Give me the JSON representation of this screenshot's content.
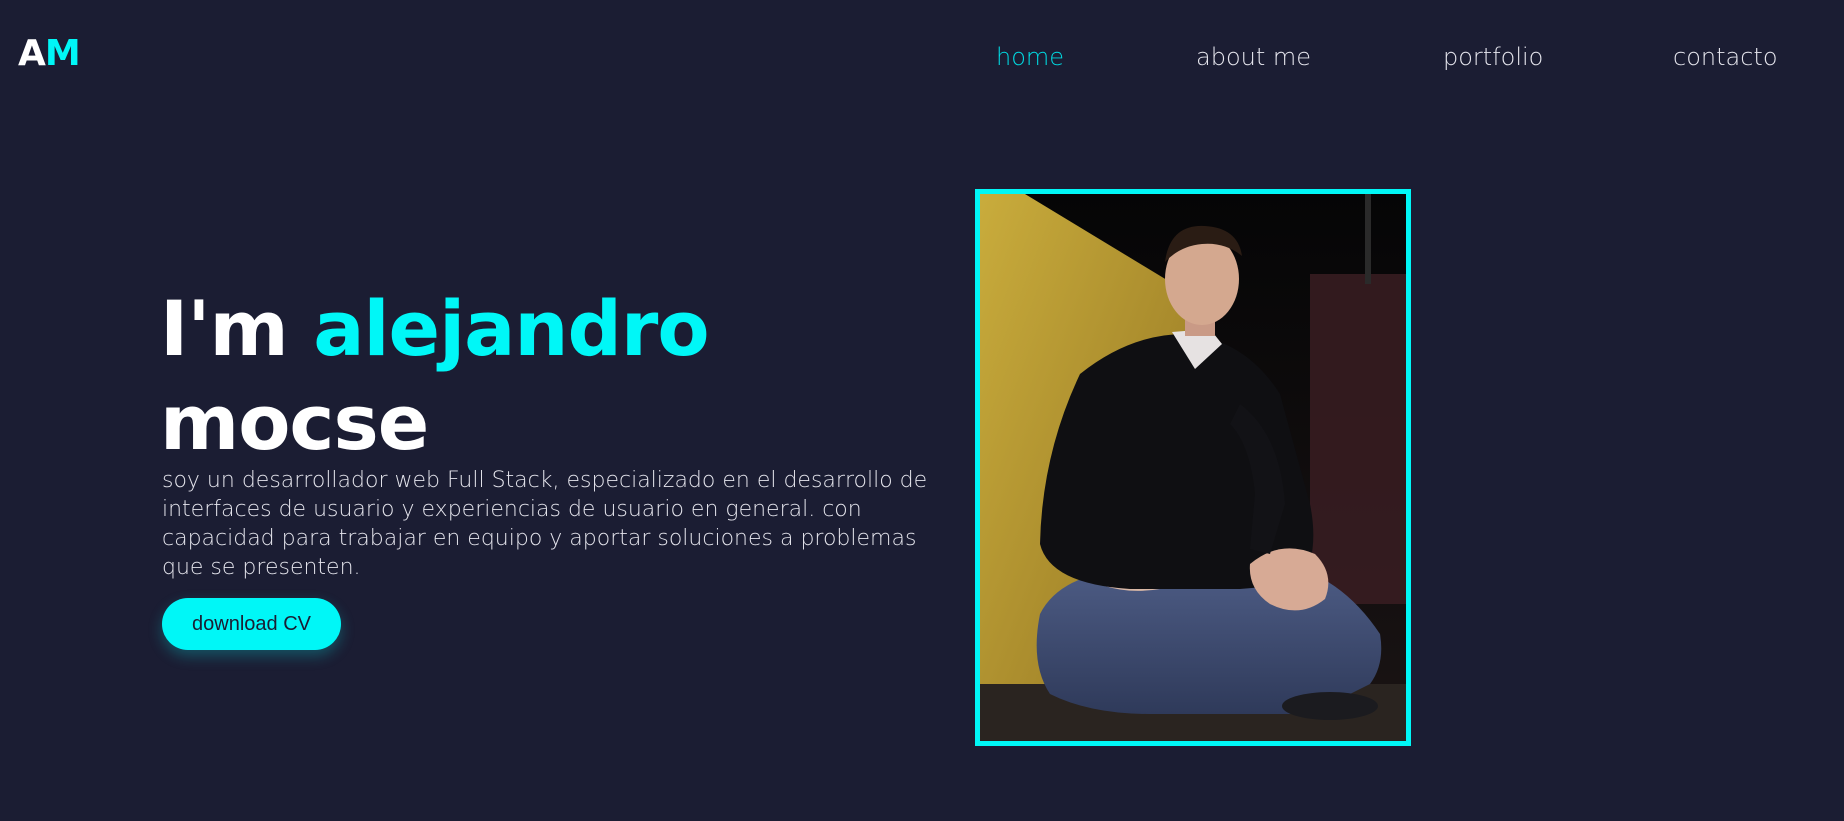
{
  "logo": {
    "first": "A",
    "second": "M"
  },
  "nav": {
    "items": [
      {
        "label": "home",
        "active": true
      },
      {
        "label": "about me",
        "active": false
      },
      {
        "label": "portfolio",
        "active": false
      },
      {
        "label": "contacto",
        "active": false
      }
    ]
  },
  "hero": {
    "title_prefix": "I'm ",
    "first_name": "alejandro",
    "last_name": "mocse",
    "description": "soy un desarrollador web Full Stack, especializado en el desarrollo de interfaces de usuario y experiencias de usuario en general. con capacidad para trabajar en equipo y aportar soluciones a problemas que se presenten.",
    "cv_button_label": "download CV"
  },
  "colors": {
    "background": "#1b1d33",
    "accent": "#00f7f7",
    "nav_active": "#00d8e0",
    "text": "#ffffff"
  }
}
